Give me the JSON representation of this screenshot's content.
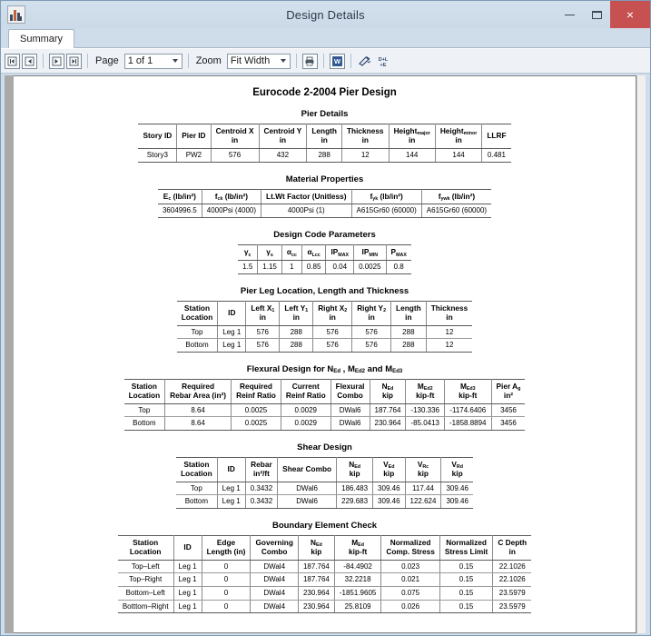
{
  "window": {
    "title": "Design Details",
    "app_icon": "building-chart-icon",
    "minimize_label": "–",
    "maximize_label": "❐",
    "close_label": "×",
    "close_color": "#c75050",
    "titlebar_color": "#cfdcea"
  },
  "tabs": [
    {
      "label": "Summary",
      "active": true
    }
  ],
  "toolbar": {
    "nav_first": "first-page",
    "nav_prev": "previous-page",
    "nav_next": "next-page",
    "nav_last": "last-page",
    "page_label": "Page",
    "page_value": "1 of 1",
    "zoom_label": "Zoom",
    "zoom_value": "Fit Width",
    "print_icon": "printer-icon",
    "export_word_icon": "word-export-icon",
    "highlight_icon": "highlighter-icon",
    "units_icon": "units-icon"
  },
  "document": {
    "title": "Eurocode 2-2004  Pier Design",
    "sections": [
      {
        "id": "pier-details",
        "title": "Pier Details",
        "headers": [
          {
            "main": "Story ID",
            "sub": "",
            "unit": ""
          },
          {
            "main": "Pier ID",
            "sub": "",
            "unit": ""
          },
          {
            "main": "Centroid X",
            "sub": "",
            "unit": "in"
          },
          {
            "main": "Centroid Y",
            "sub": "",
            "unit": "in"
          },
          {
            "main": "Length",
            "sub": "",
            "unit": "in"
          },
          {
            "main": "Thickness",
            "sub": "",
            "unit": "in"
          },
          {
            "main": "Height",
            "sub": "major",
            "unit": "in"
          },
          {
            "main": "Height",
            "sub": "minor",
            "unit": "in"
          },
          {
            "main": "LLRF",
            "sub": "",
            "unit": ""
          }
        ],
        "rows": [
          [
            "Story3",
            "PW2",
            "576",
            "432",
            "288",
            "12",
            "144",
            "144",
            "0.481"
          ]
        ]
      },
      {
        "id": "material-properties",
        "title": "Material Properties",
        "headers": [
          {
            "main": "E",
            "sub": "c",
            "unit": "",
            "suffix": " (lb/in²)"
          },
          {
            "main": "f",
            "sub": "ck",
            "unit": "",
            "suffix": " (lb/in²)"
          },
          {
            "main": "Lt.Wt Factor (Unitless)",
            "sub": "",
            "unit": ""
          },
          {
            "main": "f",
            "sub": "yk",
            "unit": "",
            "suffix": " (lb/in²)"
          },
          {
            "main": "f",
            "sub": "ywk",
            "unit": "",
            "suffix": " (lb/in²)"
          }
        ],
        "rows": [
          [
            "3604996.5",
            "4000Psi (4000)",
            "4000Psi (1)",
            "A615Gr60 (60000)",
            "A615Gr60 (60000)"
          ]
        ]
      },
      {
        "id": "design-code-parameters",
        "title": "Design Code Parameters",
        "headers": [
          {
            "main": "γ",
            "sub": "c",
            "unit": ""
          },
          {
            "main": "γ",
            "sub": "s",
            "unit": ""
          },
          {
            "main": "α",
            "sub": "cc",
            "unit": ""
          },
          {
            "main": "α",
            "sub": "Lcc",
            "unit": ""
          },
          {
            "main": "IP",
            "sub": "MAX",
            "unit": ""
          },
          {
            "main": "IP",
            "sub": "MIN",
            "unit": ""
          },
          {
            "main": "P",
            "sub": "MAX",
            "unit": ""
          }
        ],
        "rows": [
          [
            "1.5",
            "1.15",
            "1",
            "0.85",
            "0.04",
            "0.0025",
            "0.8"
          ]
        ]
      },
      {
        "id": "pier-leg-location",
        "title": "Pier Leg Location, Length and Thickness",
        "headers": [
          {
            "main": "Station\nLocation",
            "sub": "",
            "unit": ""
          },
          {
            "main": "ID",
            "sub": "",
            "unit": ""
          },
          {
            "main": "Left X",
            "sub": "1",
            "unit": "in"
          },
          {
            "main": "Left Y",
            "sub": "1",
            "unit": "in"
          },
          {
            "main": "Right X",
            "sub": "2",
            "unit": "in"
          },
          {
            "main": "Right Y",
            "sub": "2",
            "unit": "in"
          },
          {
            "main": "Length",
            "sub": "",
            "unit": "in"
          },
          {
            "main": "Thickness",
            "sub": "",
            "unit": "in"
          }
        ],
        "rows": [
          [
            "Top",
            "Leg 1",
            "576",
            "288",
            "576",
            "576",
            "288",
            "12"
          ],
          [
            "Bottom",
            "Leg 1",
            "576",
            "288",
            "576",
            "576",
            "288",
            "12"
          ]
        ]
      },
      {
        "id": "flexural-design",
        "title": "Flexural Design for N",
        "title_parts": {
          "prefix": "Flexural Design for N",
          "sub1": "Ed",
          "mid": " , M",
          "sub2": "Ed2",
          "mid2": "  and M",
          "sub3": "Ed3"
        },
        "headers": [
          {
            "main": "Station\nLocation",
            "sub": "",
            "unit": ""
          },
          {
            "main": "Required\nRebar Area (in²)",
            "sub": "",
            "unit": ""
          },
          {
            "main": "Required\nReinf Ratio",
            "sub": "",
            "unit": ""
          },
          {
            "main": "Current\nReinf Ratio",
            "sub": "",
            "unit": ""
          },
          {
            "main": "Flexural\nCombo",
            "sub": "",
            "unit": ""
          },
          {
            "main": "N",
            "sub": "Ed",
            "unit": "kip"
          },
          {
            "main": "M",
            "sub": "Ed2",
            "unit": "kip-ft"
          },
          {
            "main": "M",
            "sub": "Ed3",
            "unit": "kip-ft"
          },
          {
            "main": "Pier A",
            "sub": "g",
            "unit": "in²"
          }
        ],
        "rows": [
          [
            "Top",
            "8.64",
            "0.0025",
            "0.0029",
            "DWal6",
            "187.764",
            "-130.336",
            "-1174.6406",
            "3456"
          ],
          [
            "Bottom",
            "8.64",
            "0.0025",
            "0.0029",
            "DWal6",
            "230.964",
            "-85.0413",
            "-1858.8894",
            "3456"
          ]
        ]
      },
      {
        "id": "shear-design",
        "title": "Shear Design",
        "headers": [
          {
            "main": "Station\nLocation",
            "sub": "",
            "unit": ""
          },
          {
            "main": "ID",
            "sub": "",
            "unit": ""
          },
          {
            "main": "Rebar",
            "sub": "",
            "unit": "in²/ft"
          },
          {
            "main": "Shear Combo",
            "sub": "",
            "unit": ""
          },
          {
            "main": "N",
            "sub": "Ed",
            "unit": "kip"
          },
          {
            "main": "V",
            "sub": "Ed",
            "unit": "kip"
          },
          {
            "main": "V",
            "sub": "Rc",
            "unit": "kip"
          },
          {
            "main": "V",
            "sub": "Rd",
            "unit": "kip"
          }
        ],
        "rows": [
          [
            "Top",
            "Leg 1",
            "0.3432",
            "DWal6",
            "186.483",
            "309.46",
            "117.44",
            "309.46"
          ],
          [
            "Bottom",
            "Leg 1",
            "0.3432",
            "DWal6",
            "229.683",
            "309.46",
            "122.624",
            "309.46"
          ]
        ]
      },
      {
        "id": "boundary-element-check",
        "title": "Boundary Element Check",
        "headers": [
          {
            "main": "Station\nLocation",
            "sub": "",
            "unit": ""
          },
          {
            "main": "ID",
            "sub": "",
            "unit": ""
          },
          {
            "main": "Edge\nLength (in)",
            "sub": "",
            "unit": ""
          },
          {
            "main": "Governing\nCombo",
            "sub": "",
            "unit": ""
          },
          {
            "main": "N",
            "sub": "Ed",
            "unit": "kip"
          },
          {
            "main": "M",
            "sub": "Ed",
            "unit": "kip-ft"
          },
          {
            "main": "Normalized\nComp. Stress",
            "sub": "",
            "unit": ""
          },
          {
            "main": "Normalized\nStress Limit",
            "sub": "",
            "unit": ""
          },
          {
            "main": "C Depth",
            "sub": "",
            "unit": "in"
          }
        ],
        "rows": [
          [
            "Top–Left",
            "Leg 1",
            "0",
            "DWal4",
            "187.764",
            "-84.4902",
            "0.023",
            "0.15",
            "22.1026"
          ],
          [
            "Top–Right",
            "Leg 1",
            "0",
            "DWal4",
            "187.764",
            "32.2218",
            "0.021",
            "0.15",
            "22.1026"
          ],
          [
            "Bottom–Left",
            "Leg 1",
            "0",
            "DWal4",
            "230.964",
            "-1851.9605",
            "0.075",
            "0.15",
            "23.5979"
          ],
          [
            "Botttom–Right",
            "Leg 1",
            "0",
            "DWal4",
            "230.964",
            "25.8109",
            "0.026",
            "0.15",
            "23.5979"
          ]
        ]
      }
    ]
  }
}
